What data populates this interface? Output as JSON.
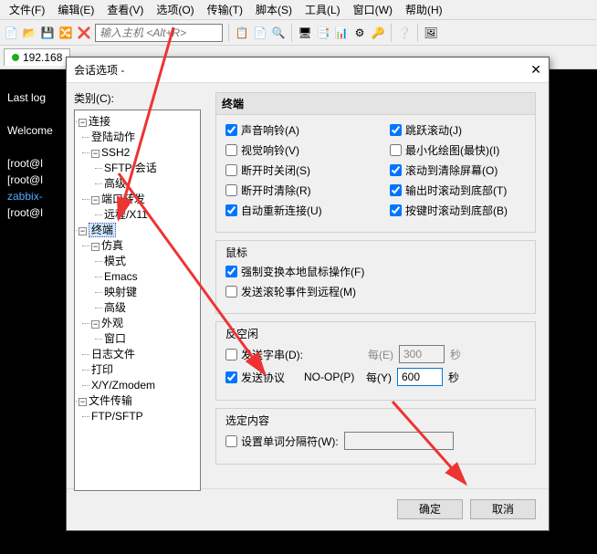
{
  "menu": {
    "file": "文件(F)",
    "edit": "编辑(E)",
    "view": "查看(V)",
    "options": "选项(O)",
    "transfer": "传输(T)",
    "script": "脚本(S)",
    "tools": "工具(L)",
    "window": "窗口(W)",
    "help": "帮助(H)"
  },
  "host_placeholder": "输入主机 <Alt+R>",
  "tab_ip": "192.168",
  "terminal": {
    "l1": "Last log",
    "l2": "Welcome",
    "l3": "[root@l",
    "l4": "[root@l",
    "l5": "zabbix-",
    "l6": "[root@l"
  },
  "dialog": {
    "title": "会话选项 - ",
    "tree_label": "类别(C):",
    "tree": {
      "connection": "连接",
      "login": "登陆动作",
      "ssh2": "SSH2",
      "sftp": "SFTP 会话",
      "advanced1": "高级",
      "port": "端口转发",
      "remote": "远程/X11",
      "terminal": "终端",
      "emulation": "仿真",
      "mode": "模式",
      "emacs": "Emacs",
      "mapkey": "映射键",
      "advanced2": "高级",
      "appearance": "外观",
      "window": "窗口",
      "logfile": "日志文件",
      "print": "打印",
      "xyz": "X/Y/Zmodem",
      "filetransfer": "文件传输",
      "ftpsftp": "FTP/SFTP"
    },
    "group_terminal": "终端",
    "chk": {
      "sound": "声音响铃(A)",
      "visual": "视觉响铃(V)",
      "closeondisc": "断开时关闭(S)",
      "clearondisc": "断开时清除(R)",
      "autoreconn": "自动重新连接(U)",
      "jumpscroll": "跳跃滚动(J)",
      "minredraw": "最小化绘图(最快)(I)",
      "scrolltoclear": "滚动到清除屏幕(O)",
      "scrollout": "输出时滚动到底部(T)",
      "scrollkey": "按键时滚动到底部(B)"
    },
    "group_mouse": "鼠标",
    "mouse": {
      "force": "强制变换本地鼠标操作(F)",
      "wheel": "发送滚轮事件到远程(M)"
    },
    "group_idle": "反空闲",
    "idle": {
      "sendstr": "发送字串(D):",
      "every1": "每(E)",
      "sec": "秒",
      "val1": "300",
      "sendproto": "发送协议",
      "noop": "NO-OP(P)",
      "every2": "每(Y)",
      "val2": "600"
    },
    "group_sel": "选定内容",
    "sel": {
      "worddelim": "设置单词分隔符(W):"
    },
    "ok": "确定",
    "cancel": "取消"
  }
}
